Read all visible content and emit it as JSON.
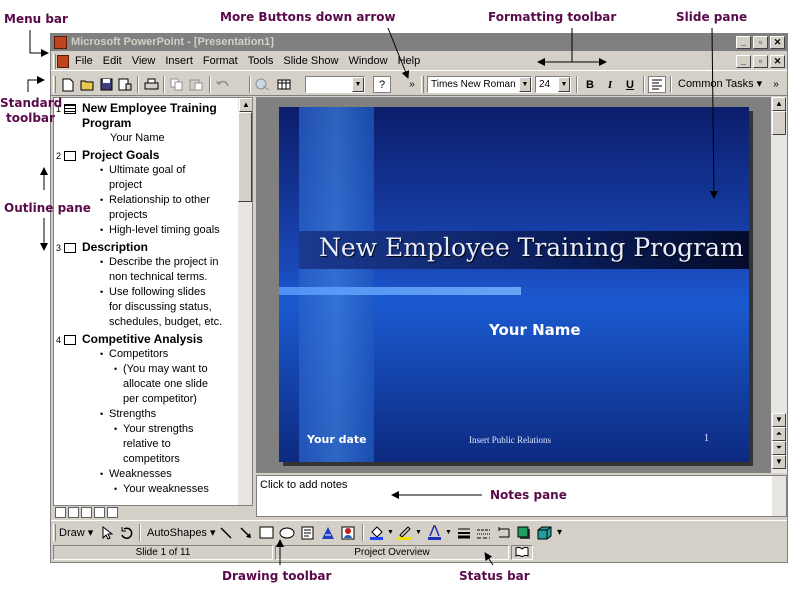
{
  "window": {
    "title": "Microsoft PowerPoint - [Presentation1]",
    "min_glyph": "_",
    "restore_glyph": "▫",
    "close_glyph": "✕"
  },
  "menu": {
    "items": [
      "File",
      "Edit",
      "View",
      "Insert",
      "Format",
      "Tools",
      "Slide Show",
      "Window",
      "Help"
    ]
  },
  "standard_toolbar": {
    "zoom_value": "",
    "help_glyph": "?",
    "more_glyph": "»"
  },
  "formatting_toolbar": {
    "font_name": "Times New Roman",
    "font_size": "24",
    "bold": "B",
    "italic": "I",
    "underline": "U",
    "common_tasks": "Common Tasks ▾",
    "more_glyph": "»"
  },
  "outline": {
    "slides": [
      {
        "number": "1",
        "title": "New Employee Training Program",
        "lines": [
          {
            "level": 0,
            "text": "Your Name"
          }
        ]
      },
      {
        "number": "2",
        "title": "Project Goals",
        "lines": [
          {
            "level": 1,
            "text": "Ultimate goal of project"
          },
          {
            "level": 1,
            "text": "Relationship to other projects"
          },
          {
            "level": 1,
            "text": "High-level timing goals"
          }
        ]
      },
      {
        "number": "3",
        "title": "Description",
        "lines": [
          {
            "level": 1,
            "text": "Describe the project in non technical terms."
          },
          {
            "level": 1,
            "text": "Use following slides for discussing status, schedules, budget, etc."
          }
        ]
      },
      {
        "number": "4",
        "title": "Competitive Analysis",
        "lines": [
          {
            "level": 1,
            "text": "Competitors"
          },
          {
            "level": 2,
            "text": "(You may want to allocate one slide per competitor)"
          },
          {
            "level": 1,
            "text": "Strengths"
          },
          {
            "level": 2,
            "text": "Your strengths relative to competitors"
          },
          {
            "level": 1,
            "text": "Weaknesses"
          },
          {
            "level": 2,
            "text": "Your weaknesses"
          }
        ]
      }
    ]
  },
  "slide": {
    "title": "New Employee Training Program",
    "subtitle": "Your Name",
    "date": "Your date",
    "footer": "Insert Public Relations",
    "number": "1",
    "colors": {
      "background": "#1a48b8",
      "title_text": "#e8ecff"
    }
  },
  "notes": {
    "placeholder": "Click to add notes"
  },
  "drawing_toolbar": {
    "draw_label": "Draw ▾",
    "autoshapes_label": "AutoShapes ▾"
  },
  "status": {
    "slide_position": "Slide 1 of 11",
    "design": "Project Overview"
  },
  "callouts": {
    "menu_bar": "Menu bar",
    "more_buttons": "More Buttons down arrow",
    "formatting_toolbar": "Formatting toolbar",
    "slide_pane": "Slide pane",
    "standard_toolbar_1": "Standard",
    "standard_toolbar_2": "toolbar",
    "outline_pane": "Outline pane",
    "notes_pane": "Notes pane",
    "drawing_toolbar": "Drawing toolbar",
    "status_bar": "Status bar"
  }
}
